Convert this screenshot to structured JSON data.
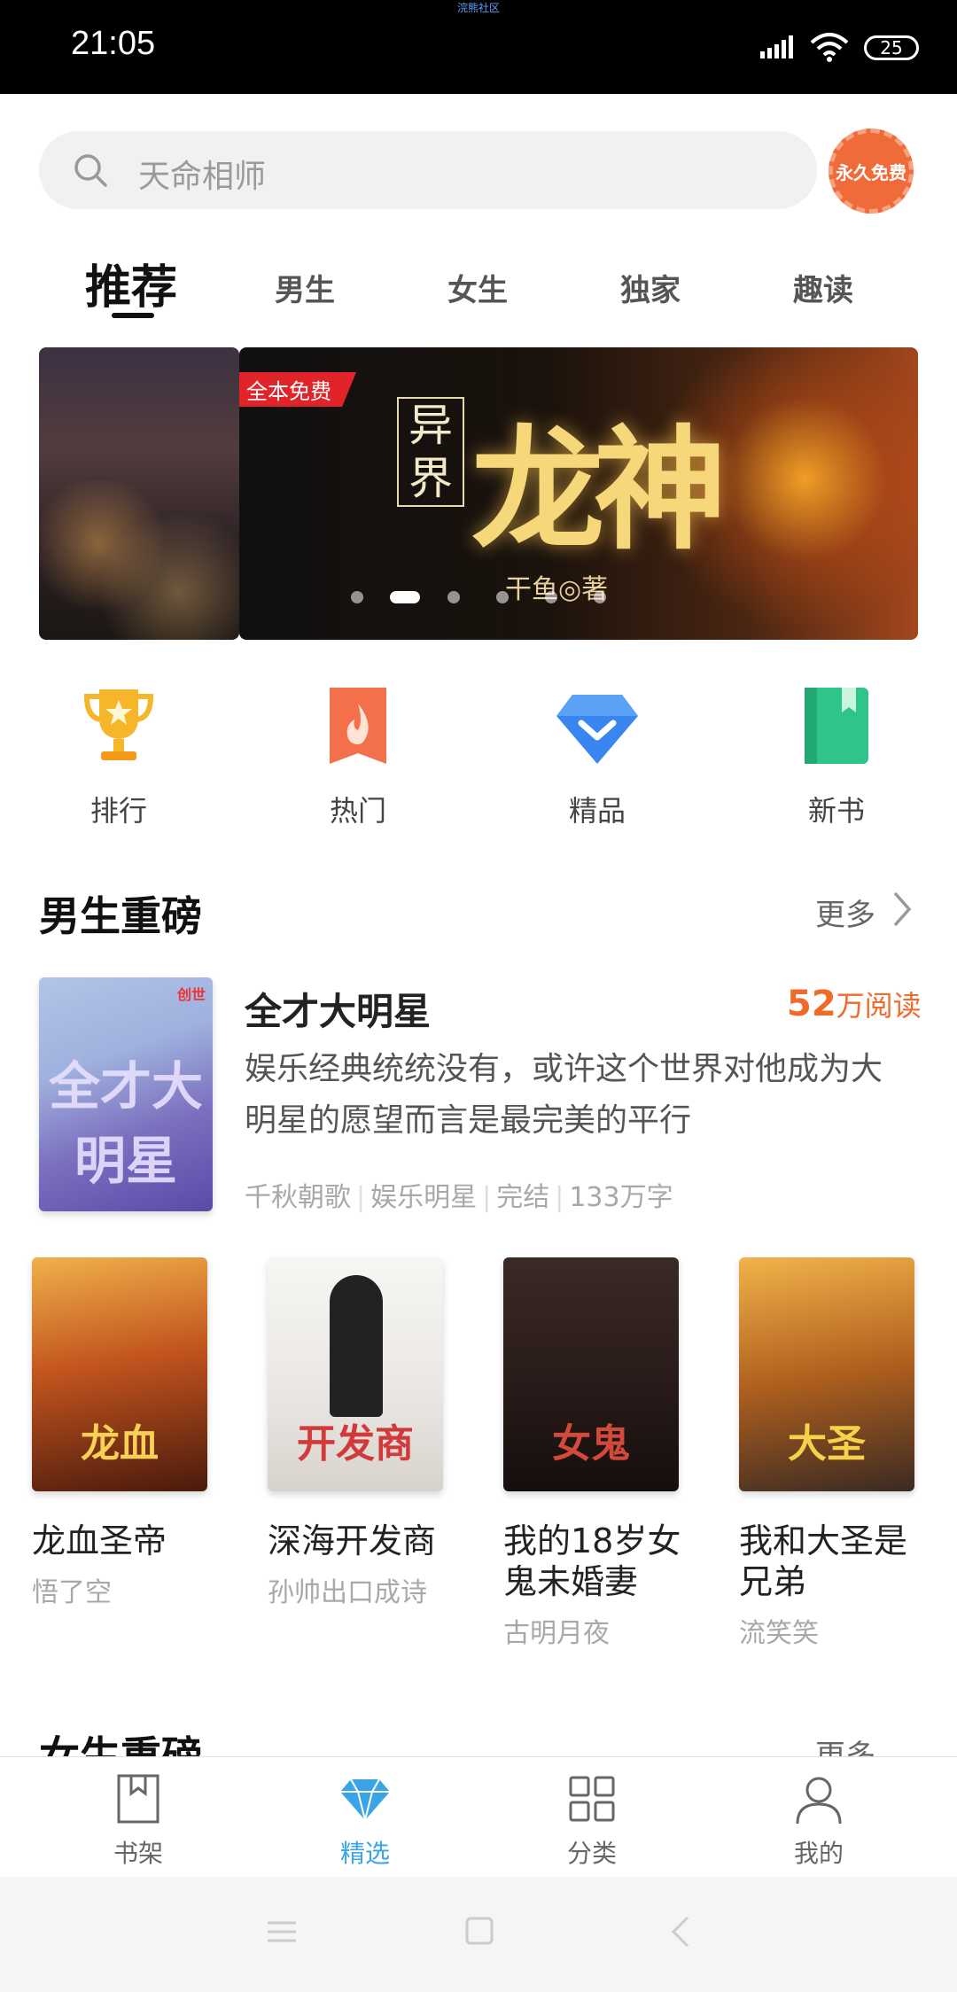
{
  "status_bar": {
    "time": "21:05",
    "carrier": "浣熊社区",
    "battery": "25"
  },
  "search": {
    "placeholder": "天命相师",
    "badge": "永久免费"
  },
  "tabs": [
    {
      "label": "推荐",
      "active": true
    },
    {
      "label": "男生"
    },
    {
      "label": "女生"
    },
    {
      "label": "独家"
    },
    {
      "label": "趣读"
    }
  ],
  "banner": {
    "tag": "全本免费",
    "title_small": "异界",
    "title_big": "龙神",
    "author": "干鱼◎著",
    "page_count": 6,
    "active_page": 2
  },
  "quick_links": [
    {
      "label": "排行",
      "icon": "trophy-icon",
      "color": "#f5b62a"
    },
    {
      "label": "热门",
      "icon": "flame-icon",
      "color": "#f4704a"
    },
    {
      "label": "精品",
      "icon": "diamond-icon",
      "color": "#3a86f0"
    },
    {
      "label": "新书",
      "icon": "book-icon",
      "color": "#2fc48a"
    }
  ],
  "section_male": {
    "title": "男生重磅",
    "more": "更多",
    "featured": {
      "title": "全才大明星",
      "reads_number": "52",
      "reads_unit": "万阅读",
      "description": "娱乐经典统统没有，或许这个世界对他成为大明星的愿望而言是最完美的平行",
      "author": "千秋朝歌",
      "category": "娱乐明星",
      "status": "完结",
      "words": "133万字",
      "cover_text": "全才大明星",
      "cover_publisher": "创世"
    },
    "books": [
      {
        "title": "龙血圣帝",
        "author": "悟了空",
        "cover_text": "龙血",
        "cover_bg": "#6a2d12",
        "cover_fg": "#f3c84a"
      },
      {
        "title": "深海开发商",
        "author": "孙帅出口成诗",
        "cover_text": "开发商",
        "cover_bg": "#f1f0ef",
        "cover_fg": "#d23a3a"
      },
      {
        "title": "我的18岁女鬼未婚妻",
        "author": "古明月夜",
        "cover_text": "女鬼",
        "cover_bg": "#2b1f1c",
        "cover_fg": "#d14a3a"
      },
      {
        "title": "我和大圣是兄弟",
        "author": "流笑笑",
        "cover_text": "大圣",
        "cover_bg": "#8a4a18",
        "cover_fg": "#f5d24a"
      }
    ]
  },
  "section_female": {
    "title": "女生重磅",
    "more": "更多"
  },
  "bottom_nav": [
    {
      "label": "书架",
      "icon": "bookshelf-icon",
      "active": false
    },
    {
      "label": "精选",
      "icon": "diamond-icon",
      "active": true
    },
    {
      "label": "分类",
      "icon": "grid-icon",
      "active": false
    },
    {
      "label": "我的",
      "icon": "profile-icon",
      "active": false
    }
  ],
  "colors": {
    "accent": "#3aa4e6",
    "reads": "#f06a2a"
  }
}
